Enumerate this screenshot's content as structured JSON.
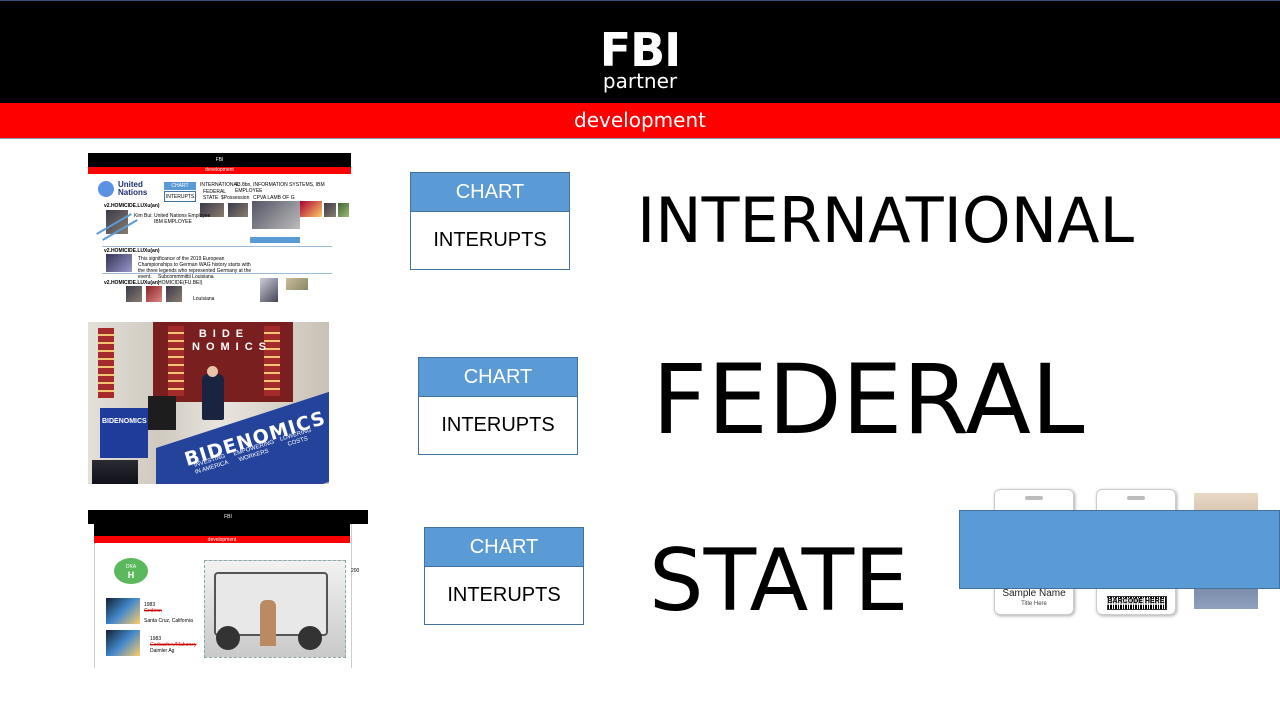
{
  "header": {
    "title": "FBI",
    "subtitle": "partner"
  },
  "banner": {
    "label": "development"
  },
  "rows": [
    {
      "chart_label": "CHART",
      "interrupt_label": "INTERUPTS",
      "heading": "INTERNATIONAL"
    },
    {
      "chart_label": "CHART",
      "interrupt_label": "INTERUPTS",
      "heading": "FEDERAL"
    },
    {
      "chart_label": "CHART",
      "interrupt_label": "INTERUPTS",
      "heading": "STATE"
    }
  ],
  "thumb1": {
    "title": "FBI",
    "banner": "development",
    "un_logo": "United Nations",
    "chart": "CHART",
    "interupts": "INTERUPTS",
    "line1": "INTERNATIONAL",
    "line1b": "43.8bn, INFORMATION SYSTEMS, IBM EMPLOYEE",
    "line2": "FEDERAL",
    "line3": "STATE",
    "line3b": "$Possession",
    "line3c": "CPVA LAMB OF G",
    "case1": "v2.HOMICIDE.LUXu(an)",
    "case1_person": "Kim Bui; United Nations Employee",
    "case1_role": "IBM EMPLOYEE",
    "case2": "v2.HOMICIDE.LUXu(an)",
    "case2_text": "This significance of the 2019 European Championships to German WAG history starts with the three legends who represented Germany at the event.",
    "case3": "v2.HOMICIDE.LUXu(an)",
    "case3_a": "Subcommmittii Louisiana",
    "case3_b": "HOMICIDE(FU.BEI)",
    "case3_c": "Louisiana"
  },
  "thumb2": {
    "window_letters": "BIDE NOMICS",
    "podium_text": "BIDENOMICS",
    "panel_1": "INVESTING IN AMERICA",
    "panel_2": "EMPOWERING WORKERS",
    "panel_3": "LOWERING COSTS",
    "sign_text": "BIDENOMICS"
  },
  "thumb3": {
    "title": "FBI",
    "banner": "development",
    "dka": "DKA",
    "dka_letter": "H",
    "entry1_year": "1983",
    "entry1_name": "Gridiron",
    "entry1_place": "Santa Cruz, California",
    "entry2_year": "1983",
    "entry2_name": "Gorbachev/Mahoney",
    "entry2_place": "Daimler Ag",
    "side_num": "200"
  },
  "badges": {
    "badge1_name": "Sample Name",
    "badge1_title": "Title Here",
    "badge2_barcode": "BARCODE HERE"
  },
  "colors": {
    "header": "#000000",
    "banner": "#ff0000",
    "accent": "#5b9bd5",
    "accent_border": "#41719c"
  }
}
